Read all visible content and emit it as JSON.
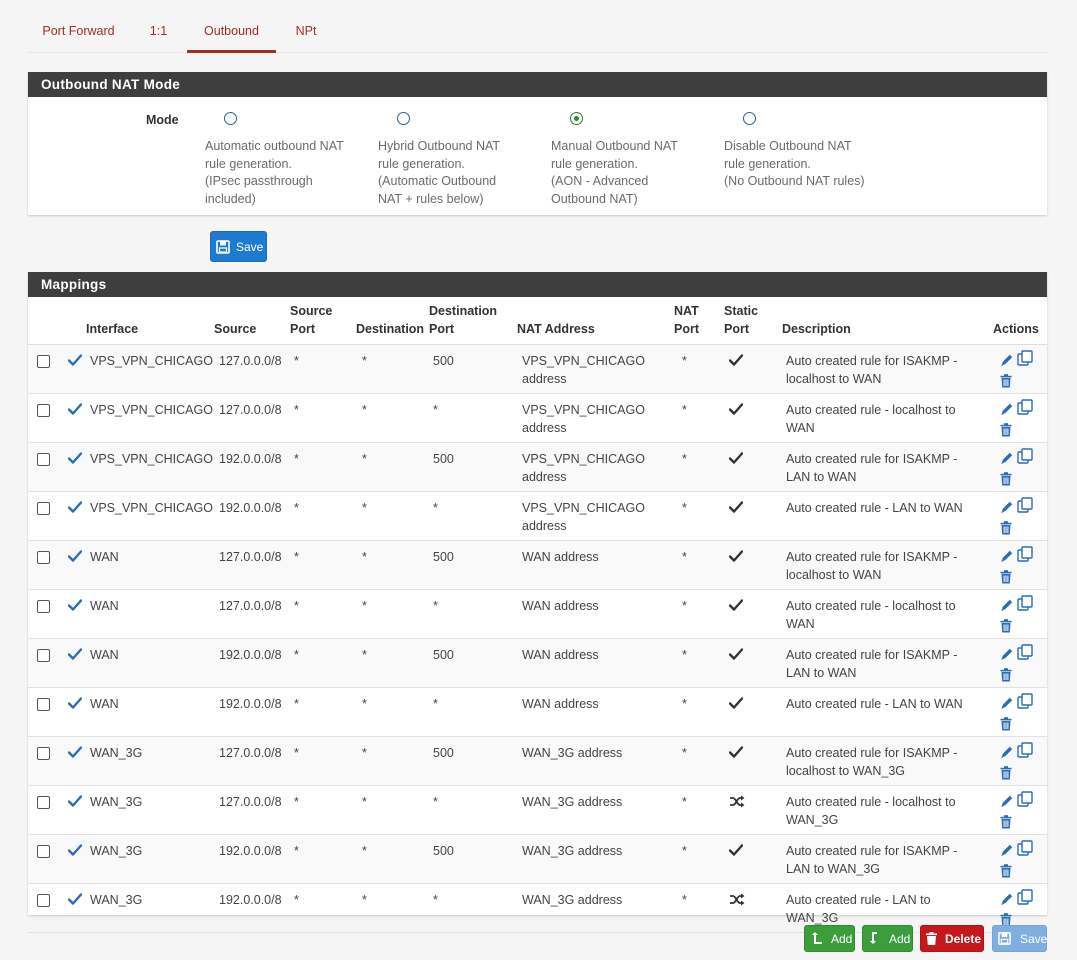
{
  "tabs": [
    "Port Forward",
    "1:1",
    "Outbound",
    "NPt"
  ],
  "outbound_mode": {
    "heading": "Outbound NAT Mode",
    "mode_label": "Mode",
    "options": [
      {
        "lines": [
          "Automatic outbound NAT",
          "rule generation.",
          "(IPsec passthrough",
          "included)"
        ],
        "checked": false
      },
      {
        "lines": [
          "Hybrid Outbound NAT",
          "rule generation.",
          "(Automatic Outbound",
          "NAT + rules below)"
        ],
        "checked": false
      },
      {
        "lines": [
          "Manual Outbound NAT",
          "rule generation.",
          "(AON - Advanced",
          "Outbound NAT)"
        ],
        "checked": true
      },
      {
        "lines": [
          "Disable Outbound NAT",
          "rule generation.",
          "(No Outbound NAT rules)"
        ],
        "checked": false
      }
    ],
    "save_label": "Save"
  },
  "mappings": {
    "heading": "Mappings",
    "columns": [
      "Interface",
      "Source",
      "Source Port",
      "Destination",
      "Destination Port",
      "NAT Address",
      "NAT Port",
      "Static Port",
      "Description",
      "Actions"
    ],
    "rows": [
      {
        "interface": "VPS_VPN_CHICAGO",
        "source": "127.0.0.0/8",
        "source_port": "*",
        "destination": "*",
        "dest_port": "500",
        "nat_address": "VPS_VPN_CHICAGO address",
        "nat_port": "*",
        "static_port": "check",
        "description": "Auto created rule for ISAKMP - localhost to WAN"
      },
      {
        "interface": "VPS_VPN_CHICAGO",
        "source": "127.0.0.0/8",
        "source_port": "*",
        "destination": "*",
        "dest_port": "*",
        "nat_address": "VPS_VPN_CHICAGO address",
        "nat_port": "*",
        "static_port": "check",
        "description": "Auto created rule - localhost to WAN"
      },
      {
        "interface": "VPS_VPN_CHICAGO",
        "source": "192.0.0.0/8",
        "source_port": "*",
        "destination": "*",
        "dest_port": "500",
        "nat_address": "VPS_VPN_CHICAGO address",
        "nat_port": "*",
        "static_port": "check",
        "description": "Auto created rule for ISAKMP - LAN to WAN"
      },
      {
        "interface": "VPS_VPN_CHICAGO",
        "source": "192.0.0.0/8",
        "source_port": "*",
        "destination": "*",
        "dest_port": "*",
        "nat_address": "VPS_VPN_CHICAGO address",
        "nat_port": "*",
        "static_port": "check",
        "description": "Auto created rule - LAN to WAN"
      },
      {
        "interface": "WAN",
        "source": "127.0.0.0/8",
        "source_port": "*",
        "destination": "*",
        "dest_port": "500",
        "nat_address": "WAN address",
        "nat_port": "*",
        "static_port": "check",
        "description": "Auto created rule for ISAKMP - localhost to WAN"
      },
      {
        "interface": "WAN",
        "source": "127.0.0.0/8",
        "source_port": "*",
        "destination": "*",
        "dest_port": "*",
        "nat_address": "WAN address",
        "nat_port": "*",
        "static_port": "check",
        "description": "Auto created rule - localhost to WAN"
      },
      {
        "interface": "WAN",
        "source": "192.0.0.0/8",
        "source_port": "*",
        "destination": "*",
        "dest_port": "500",
        "nat_address": "WAN address",
        "nat_port": "*",
        "static_port": "check",
        "description": "Auto created rule for ISAKMP - LAN to WAN"
      },
      {
        "interface": "WAN",
        "source": "192.0.0.0/8",
        "source_port": "*",
        "destination": "*",
        "dest_port": "*",
        "nat_address": "WAN address",
        "nat_port": "*",
        "static_port": "check",
        "description": "Auto created rule - LAN to WAN"
      },
      {
        "interface": "WAN_3G",
        "source": "127.0.0.0/8",
        "source_port": "*",
        "destination": "*",
        "dest_port": "500",
        "nat_address": "WAN_3G address",
        "nat_port": "*",
        "static_port": "check",
        "description": "Auto created rule for ISAKMP - localhost to WAN_3G"
      },
      {
        "interface": "WAN_3G",
        "source": "127.0.0.0/8",
        "source_port": "*",
        "destination": "*",
        "dest_port": "*",
        "nat_address": "WAN_3G address",
        "nat_port": "*",
        "static_port": "random",
        "description": "Auto created rule - localhost to WAN_3G"
      },
      {
        "interface": "WAN_3G",
        "source": "192.0.0.0/8",
        "source_port": "*",
        "destination": "*",
        "dest_port": "500",
        "nat_address": "WAN_3G address",
        "nat_port": "*",
        "static_port": "check",
        "description": "Auto created rule for ISAKMP - LAN to WAN_3G"
      },
      {
        "interface": "WAN_3G",
        "source": "192.0.0.0/8",
        "source_port": "*",
        "destination": "*",
        "dest_port": "*",
        "nat_address": "WAN_3G address",
        "nat_port": "*",
        "static_port": "random",
        "description": "Auto created rule - LAN to WAN_3G"
      }
    ]
  },
  "footer_buttons": {
    "add_top_label": "Add",
    "add_bottom_label": "Add",
    "delete_label": "Delete",
    "save_label": "Save"
  },
  "colors": {
    "accent_red": "#a22d28",
    "primary_blue": "#1e7ad1",
    "success_green": "#3b9d3c",
    "danger_red": "#c5171c",
    "icon_blue": "#2b6cb5"
  }
}
